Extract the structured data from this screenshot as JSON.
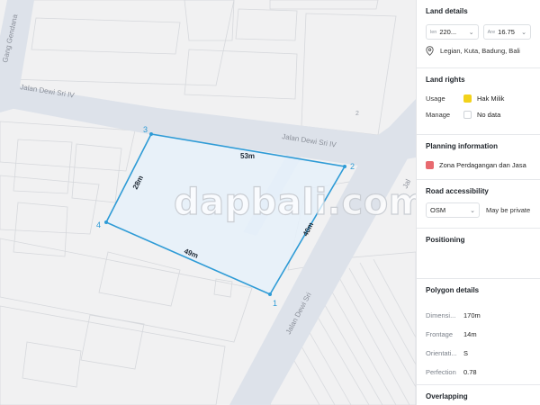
{
  "map": {
    "streets": {
      "gang": "Gang Gendana",
      "dewi_sri_iv_left": "Jalan Dewi Sri IV",
      "dewi_sri_iv_right": "Jalan Dewi Sri IV",
      "dewi_sri_main": "Jalan Dewi Sri",
      "edge_cut": "Jal"
    },
    "watermark": "dapbali.com",
    "parcel_number": "2",
    "polygon": {
      "vertices": [
        "1",
        "2",
        "3",
        "4"
      ],
      "edges": [
        "53m",
        "40m",
        "49m",
        "28m"
      ]
    },
    "colors": {
      "polygon_stroke": "#2e9bd6",
      "polygon_fill": "#e6f1fa",
      "road": "#dde2ea"
    }
  },
  "panel": {
    "land_details": {
      "title": "Land details",
      "width_unit": "len",
      "width_value": "220...",
      "area_unit": "Are",
      "area_value": "16.75",
      "location": "Legian, Kuta, Badung, Bali"
    },
    "land_rights": {
      "title": "Land rights",
      "usage_label": "Usage",
      "usage_value": "Hak Milik",
      "usage_color": "#f2d21b",
      "manage_label": "Manage",
      "manage_value": "No data"
    },
    "planning": {
      "title": "Planning information",
      "zone": "Zona Perdagangan dan Jasa",
      "zone_color": "#e86a6f"
    },
    "road_access": {
      "title": "Road accessibility",
      "source": "OSM",
      "note": "May be private"
    },
    "positioning": {
      "title": "Positioning"
    },
    "polygon_details": {
      "title": "Polygon details",
      "rows": [
        {
          "label": "Dimensi...",
          "value": "170m"
        },
        {
          "label": "Frontage",
          "value": "14m"
        },
        {
          "label": "Orientati...",
          "value": "S"
        },
        {
          "label": "Perfection",
          "value": "0.78"
        }
      ]
    },
    "overlapping": {
      "title": "Overlapping"
    }
  }
}
